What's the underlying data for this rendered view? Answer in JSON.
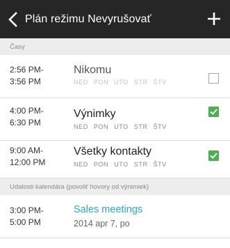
{
  "header": {
    "title": "Plán režimu Nevyrušovať",
    "back_icon": "chevron-left-icon",
    "add_icon": "plus-icon"
  },
  "sections": {
    "times_label": "Časy",
    "calendar_label": "Udalosti kalendára (povoliť hovory od výnimiek)"
  },
  "schedules": [
    {
      "start": "2:56 PM-",
      "end": "3:56 PM",
      "name": "Nikomu",
      "days": [
        "NED",
        "PON",
        "UTO",
        "STR",
        "ŠTV"
      ],
      "checked": false
    },
    {
      "start": "4:00 PM-",
      "end": "6:30 PM",
      "name": "Výnimky",
      "days": [
        "NED",
        "PON",
        "UTO",
        "STR",
        "ŠTV"
      ],
      "checked": true
    },
    {
      "start": "9:00 AM-",
      "end": "12:00 PM",
      "name": "Všetky kontakty",
      "days": [
        "NED",
        "PON",
        "UTO",
        "STR",
        "ŠTV"
      ],
      "checked": true
    }
  ],
  "events": [
    {
      "start": "3:00 PM-",
      "end": "5:00 PM",
      "title": "Sales meetings",
      "date": "2014 apr 7, po"
    }
  ],
  "colors": {
    "header_bg": "#262626",
    "accent_green": "#4caf50",
    "event_blue": "#23a8d6",
    "section_bg": "#ededed"
  }
}
